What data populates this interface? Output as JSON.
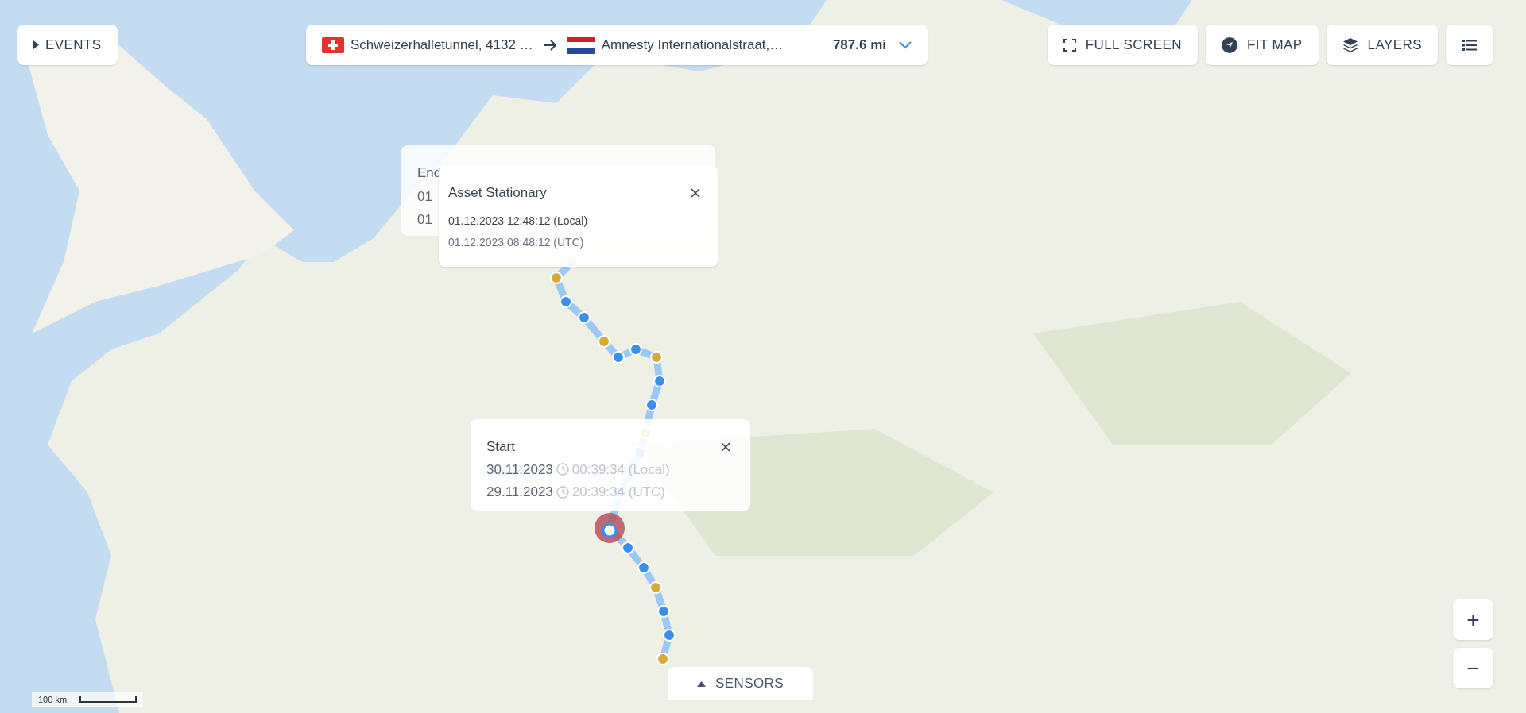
{
  "events_button": {
    "label": "EVENTS"
  },
  "route": {
    "origin": {
      "kind": "swiss",
      "text": "Schweizerhalletunnel, 4132 …"
    },
    "destination": {
      "kind": "dutch",
      "text": "Amnesty Internationalstraat,…"
    },
    "distance": "787.6 mi"
  },
  "toolbar": [
    {
      "kind": "fullscreen",
      "label": "FULL SCREEN"
    },
    {
      "kind": "fit",
      "label": "FIT MAP"
    },
    {
      "kind": "layers",
      "label": "LAYERS"
    },
    {
      "kind": "list"
    }
  ],
  "popups": [
    {
      "kind": "end",
      "title": "End",
      "lines": [
        "01",
        "01"
      ]
    },
    {
      "kind": "stationary",
      "title": "Asset Stationary",
      "lines": [
        "01.12.2023 12:48:12 (Local)",
        "01.12.2023 08:48:12 (UTC)"
      ]
    },
    {
      "kind": "start",
      "title": "Start",
      "lines": [
        {
          "date": "30.11.2023",
          "time": "00:39:34 (Local)"
        },
        {
          "date": "29.11.2023",
          "time": "20:39:34 (UTC)"
        }
      ]
    }
  ],
  "sensors_button": {
    "label": "SENSORS"
  },
  "zoom_controls": [
    "+",
    "−"
  ],
  "scale": {
    "label": "100 km"
  }
}
